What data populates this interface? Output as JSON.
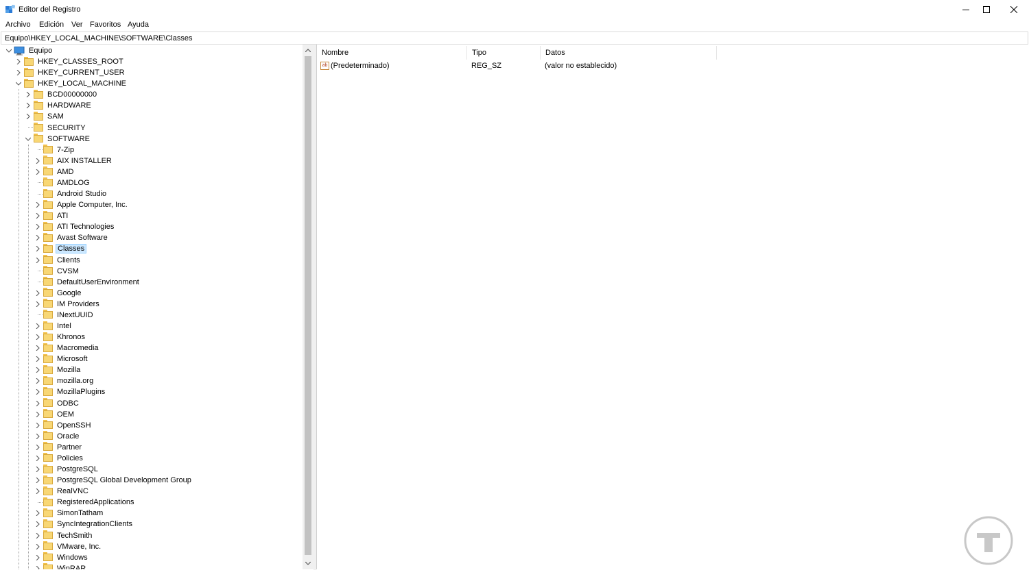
{
  "window": {
    "title": "Editor del Registro"
  },
  "menu": [
    "Archivo",
    "Edición",
    "Ver",
    "Favoritos",
    "Ayuda"
  ],
  "address": "Equipo\\HKEY_LOCAL_MACHINE\\SOFTWARE\\Classes",
  "tree": {
    "root": "Equipo",
    "hives": [
      {
        "label": "HKEY_CLASSES_ROOT",
        "expandable": true
      },
      {
        "label": "HKEY_CURRENT_USER",
        "expandable": true
      },
      {
        "label": "HKEY_LOCAL_MACHINE",
        "expanded": true
      }
    ],
    "hklm_children": [
      {
        "label": "BCD00000000",
        "expandable": true
      },
      {
        "label": "HARDWARE",
        "expandable": true
      },
      {
        "label": "SAM",
        "expandable": true
      },
      {
        "label": "SECURITY",
        "expandable": false
      },
      {
        "label": "SOFTWARE",
        "expanded": true
      }
    ],
    "software_children": [
      {
        "label": "7-Zip",
        "expandable": false
      },
      {
        "label": "AIX INSTALLER",
        "expandable": true
      },
      {
        "label": "AMD",
        "expandable": true
      },
      {
        "label": "AMDLOG",
        "expandable": false
      },
      {
        "label": "Android Studio",
        "expandable": false
      },
      {
        "label": "Apple Computer, Inc.",
        "expandable": true
      },
      {
        "label": "ATI",
        "expandable": true
      },
      {
        "label": "ATI Technologies",
        "expandable": true
      },
      {
        "label": "Avast Software",
        "expandable": true
      },
      {
        "label": "Classes",
        "expandable": true,
        "selected": true
      },
      {
        "label": "Clients",
        "expandable": true
      },
      {
        "label": "CVSM",
        "expandable": false
      },
      {
        "label": "DefaultUserEnvironment",
        "expandable": false
      },
      {
        "label": "Google",
        "expandable": true
      },
      {
        "label": "IM Providers",
        "expandable": true
      },
      {
        "label": "INextUUID",
        "expandable": false
      },
      {
        "label": "Intel",
        "expandable": true
      },
      {
        "label": "Khronos",
        "expandable": true
      },
      {
        "label": "Macromedia",
        "expandable": true
      },
      {
        "label": "Microsoft",
        "expandable": true
      },
      {
        "label": "Mozilla",
        "expandable": true
      },
      {
        "label": "mozilla.org",
        "expandable": true
      },
      {
        "label": "MozillaPlugins",
        "expandable": true
      },
      {
        "label": "ODBC",
        "expandable": true
      },
      {
        "label": "OEM",
        "expandable": true
      },
      {
        "label": "OpenSSH",
        "expandable": true
      },
      {
        "label": "Oracle",
        "expandable": true
      },
      {
        "label": "Partner",
        "expandable": true
      },
      {
        "label": "Policies",
        "expandable": true
      },
      {
        "label": "PostgreSQL",
        "expandable": true
      },
      {
        "label": "PostgreSQL Global Development Group",
        "expandable": true
      },
      {
        "label": "RealVNC",
        "expandable": true
      },
      {
        "label": "RegisteredApplications",
        "expandable": false
      },
      {
        "label": "SimonTatham",
        "expandable": true
      },
      {
        "label": "SyncIntegrationClients",
        "expandable": true
      },
      {
        "label": "TechSmith",
        "expandable": true
      },
      {
        "label": "VMware, Inc.",
        "expandable": true
      },
      {
        "label": "Windows",
        "expandable": true
      },
      {
        "label": "WinRAR",
        "expandable": true
      }
    ]
  },
  "list": {
    "columns": [
      "Nombre",
      "Tipo",
      "Datos"
    ],
    "rows": [
      {
        "icon": "string-value-icon",
        "icon_text": "ab",
        "name": "(Predeterminado)",
        "type": "REG_SZ",
        "data": "(valor no establecido)"
      }
    ]
  },
  "colors": {
    "selection": "#cce8ff",
    "folder": "#f8d775",
    "accent": "#0078d7"
  }
}
